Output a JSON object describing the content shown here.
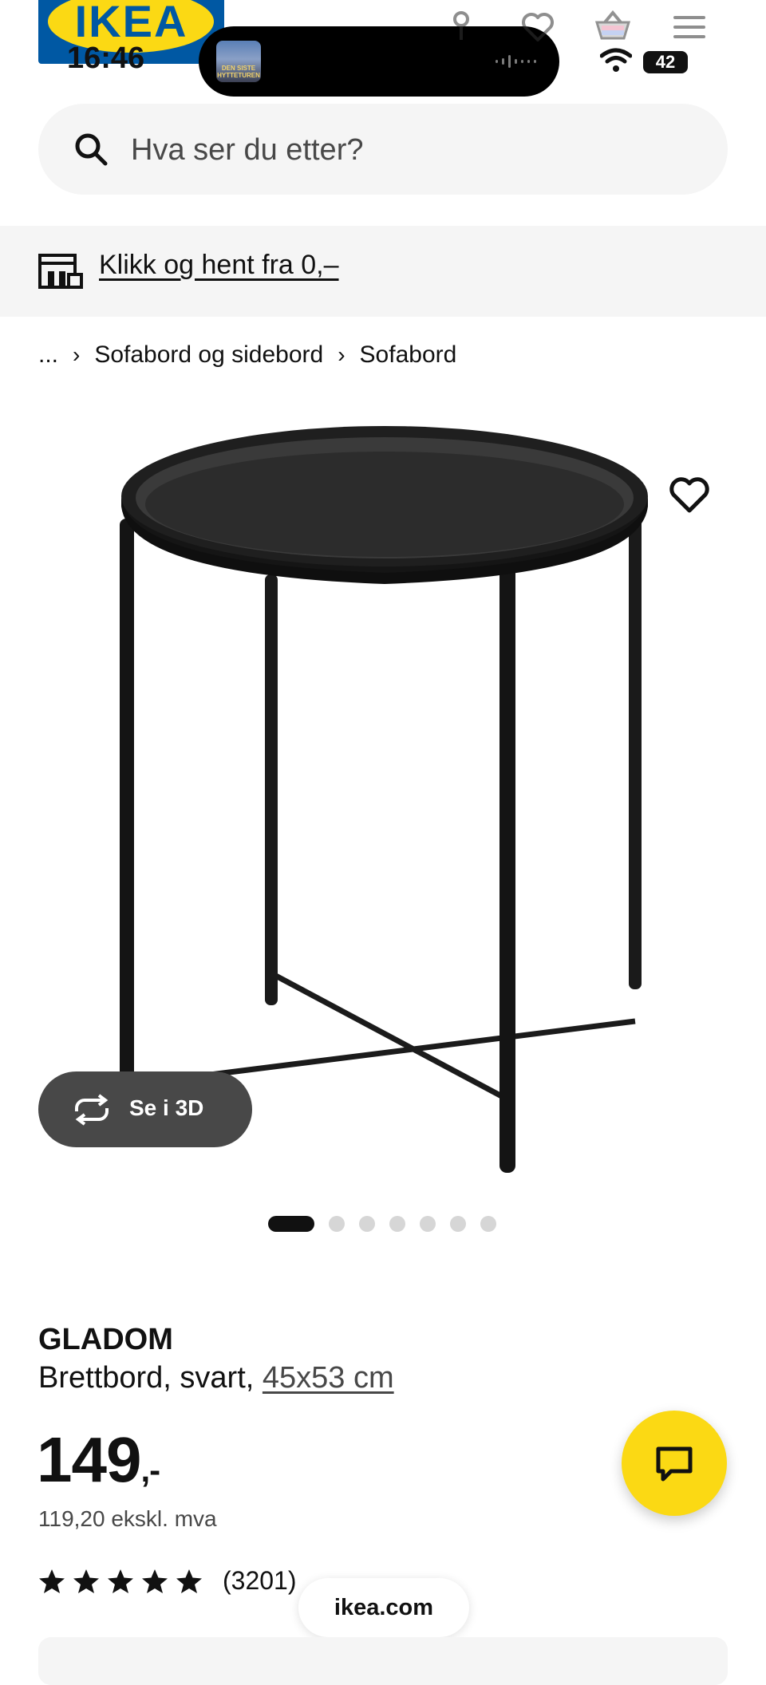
{
  "status_bar": {
    "time": "16:46",
    "battery": "42",
    "now_playing_art": "DEN SISTE HYTTETUREN"
  },
  "brand": {
    "logo": "IKEA"
  },
  "header": {
    "icons": [
      "location-pin-icon",
      "heart-icon",
      "basket-icon",
      "menu-icon"
    ]
  },
  "search": {
    "placeholder": "Hva ser du etter?"
  },
  "click_collect": {
    "label": "Klikk og hent fra 0,–"
  },
  "breadcrumb": {
    "items": [
      "...",
      "Sofabord og sidebord",
      "Sofabord"
    ]
  },
  "gallery": {
    "view_3d_label": "Se i 3D",
    "image_count": 7,
    "active_index": 0
  },
  "product": {
    "name": "GLADOM",
    "description": "Brettbord, svart,",
    "size": "45x53 cm",
    "price": "149",
    "price_suffix": ",-",
    "price_ex_vat": "119,20 ekskl. mva",
    "rating_stars": 5,
    "review_count": "(3201)"
  },
  "browser": {
    "url": "ikea.com"
  },
  "colors": {
    "ikea_blue": "#0058A3",
    "ikea_yellow": "#FBD914",
    "text_dark": "#111111",
    "text_muted": "#484848",
    "surface_grey": "#F5F5F5"
  }
}
